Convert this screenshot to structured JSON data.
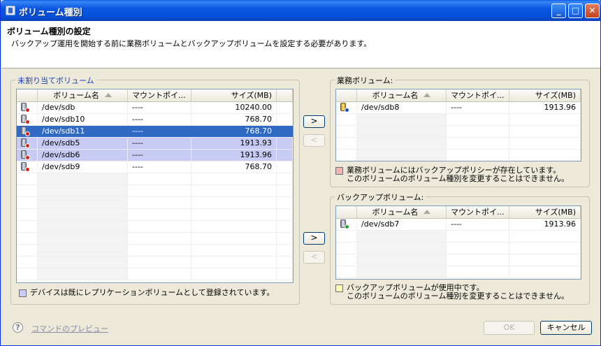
{
  "window": {
    "title": "ボリューム種別",
    "controls": {
      "minimize": "_",
      "maximize": "□",
      "close": "✕"
    }
  },
  "header": {
    "title": "ボリューム種別の設定",
    "description": "バックアップ運用を開始する前に業務ボリュームとバックアップボリュームを設定する必要があります。"
  },
  "unassigned": {
    "label": "未割り当てボリューム",
    "columns": [
      "ボリューム名",
      "マウントポイ...",
      "サイズ(MB)"
    ],
    "rows": [
      {
        "name": "/dev/sdb",
        "mount": "----",
        "size": "10240.00",
        "state": "normal"
      },
      {
        "name": "/dev/sdb10",
        "mount": "----",
        "size": "768.70",
        "state": "normal"
      },
      {
        "name": "/dev/sdb11",
        "mount": "----",
        "size": "768.70",
        "state": "selected"
      },
      {
        "name": "/dev/sdb5",
        "mount": "----",
        "size": "1913.93",
        "state": "replication"
      },
      {
        "name": "/dev/sdb6",
        "mount": "----",
        "size": "1913.96",
        "state": "replication"
      },
      {
        "name": "/dev/sdb9",
        "mount": "----",
        "size": "768.70",
        "state": "normal"
      }
    ],
    "legend": "デバイスは既にレプリケーションボリュームとして登録されています。",
    "legend_color": "#c8ccf4"
  },
  "business": {
    "label": "業務ボリューム:",
    "columns": [
      "ボリューム名",
      "マウントポイ...",
      "サイズ(MB)"
    ],
    "rows": [
      {
        "name": "/dev/sdb8",
        "mount": "----",
        "size": "1913.96"
      }
    ],
    "legend_line1": "業務ボリュームにはバックアップポリシーが存在しています。",
    "legend_line2": "このボリュームのボリューム種別を変更することはできません。",
    "legend_color": "#f4b4b4"
  },
  "backup": {
    "label": "バックアップボリューム:",
    "columns": [
      "ボリューム名",
      "マウントポイ...",
      "サイズ(MB)"
    ],
    "rows": [
      {
        "name": "/dev/sdb7",
        "mount": "----",
        "size": "1913.96"
      }
    ],
    "legend_line1": "バックアップボリュームが使用中です。",
    "legend_line2": "このボリュームのボリューム種別を変更することはできません。",
    "legend_color": "#fcfcb0"
  },
  "arrows": {
    "right": ">",
    "left": "<"
  },
  "footer": {
    "help": "?",
    "preview_link": "コマンドのプレビュー",
    "ok": "OK",
    "cancel": "キャンセル"
  }
}
